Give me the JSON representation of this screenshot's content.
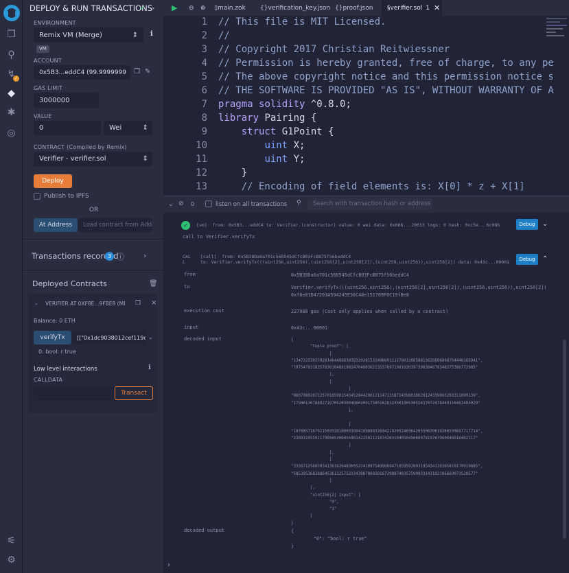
{
  "panel": {
    "title": "DEPLOY & RUN TRANSACTIONS",
    "env_label": "ENVIRONMENT",
    "env_value": "Remix VM (Merge)",
    "vm_badge": "VM",
    "account_label": "ACCOUNT",
    "account_value": "0x5B3...eddC4 (99.9999999",
    "gas_label": "GAS LIMIT",
    "gas_value": "3000000",
    "value_label": "VALUE",
    "value_value": "0",
    "unit": "Wei",
    "contract_label": "CONTRACT (Compiled by Remix)",
    "contract_value": "Verifier - verifier.sol",
    "deploy": "Deploy",
    "ipfs": "Publish to IPFS",
    "or": "OR",
    "at_address": "At Address",
    "load_placeholder": "Load contract from Address",
    "tx_recorded": "Transactions recorded",
    "tx_count": "3",
    "deployed": "Deployed Contracts",
    "verifier_at": "VERIFIER AT 0XF8E...9FBE8 (MEM",
    "balance": "Balance: 0 ETH",
    "verify_btn": "verifyTx",
    "verify_input": "[[\"0x1dc9038012cef119c7",
    "result": "0: bool: r true",
    "low_level": "Low level interactions",
    "calldata": "CALLDATA",
    "transact": "Transact"
  },
  "tabs": [
    {
      "label": "main.zok"
    },
    {
      "label": "verification_key.json"
    },
    {
      "label": "proof.json"
    },
    {
      "label": "verifier.sol",
      "badge": "1"
    }
  ],
  "editor": {
    "lines": [
      {
        "n": "1",
        "text": "// This file is MIT Licensed."
      },
      {
        "n": "2",
        "text": "//"
      },
      {
        "n": "3",
        "text": "// Copyright 2017 Christian Reitwiessner"
      },
      {
        "n": "4",
        "text": "// Permission is hereby granted, free of charge, to any pe"
      },
      {
        "n": "5",
        "text": "// The above copyright notice and this permission notice s"
      },
      {
        "n": "6",
        "text": "// THE SOFTWARE IS PROVIDED \"AS IS\", WITHOUT WARRANTY OF A"
      },
      {
        "n": "7",
        "text": "pragma solidity ^0.8.0;"
      },
      {
        "n": "8",
        "text": "library Pairing {"
      },
      {
        "n": "9",
        "text": "    struct G1Point {"
      },
      {
        "n": "10",
        "text": "        uint X;"
      },
      {
        "n": "11",
        "text": "        uint Y;"
      },
      {
        "n": "12",
        "text": "    }"
      },
      {
        "n": "13",
        "text": "    // Encoding of field elements is: X[0] * z + X[1]"
      }
    ]
  },
  "terminal": {
    "count": "0",
    "listen": "listen on all transactions",
    "search_placeholder": "Search with transaction hash or address",
    "tx1": "[vm]  from: 0x5B3...eddC4 to: Verifier.(constructor) value: 0 wei data: 0x608...20033 logs: 0 hash: 0xc5e...6c08b",
    "call_line": "call to Verifier.verifyTx",
    "call_hdr": "[call]  from: 0x5B38Da6a701c568545dCfcB03FcB875f56beddC4",
    "call_hdr2": "to: Verifier.verifyTx(((uint256,uint256),(uint256[2],uint256[2]),(uint256,uint256)),uint256[2]) data: 0x43c...00001",
    "call_tag": "CAL\nL",
    "debug": "Debug",
    "rows": [
      {
        "k": "from",
        "v": "0x5B38Da6a701c568545dCfcB03FcB875f56beddC4"
      },
      {
        "k": "to",
        "v": "Verifier.verifyTx(((uint256,uint256),(uint256[2],uint256[2]),(uint256,uint256)),uint256[2])\n0xf8e81D47203A594245E36C48e151709F0C19fBe8"
      },
      {
        "k": "execution cost",
        "v": "227980 gas (Cost only applies when called by a contract)"
      },
      {
        "k": "input",
        "v": "0x43c...00001"
      },
      {
        "k": "decoded input",
        "v": "{\n        \"tuple proof\": [\n                [\n\"13472233027028146448663838320281531496691111780130658813626606898754448166941\",\n\"7075479318357830104891982470460362135576971901020397398384676348375386772985\"\n                ],\n                [\n                        [\n\"9807080207225701659015454528442961211471358714398038626124339065293311099139\",\n\"17946126788927107052830948602031758516281435018053855437672478449116463483929\"\n                        ],\n\n                        [\n\"18768571679215035201000339941090983269421929524036426550629619266530697717714\",\n\"2389310559117995653964559814225021210742631940504566007819767960046016402117\"\n                        ]\n                ],\n                [\n\"33367125683034136162648365522410975499069471059592803195434120365810179919885\",\n\"5853953683886453611257523343887860301672988748357599833143102186669073520577\"\n                ]\n        ],\n        \"uint256[2] input\": [\n                \"0\",\n                \"1\"\n        ]\n}"
      },
      {
        "k": "decoded output",
        "v": "{\n        \"0\": \"bool: r true\"\n}"
      }
    ]
  }
}
